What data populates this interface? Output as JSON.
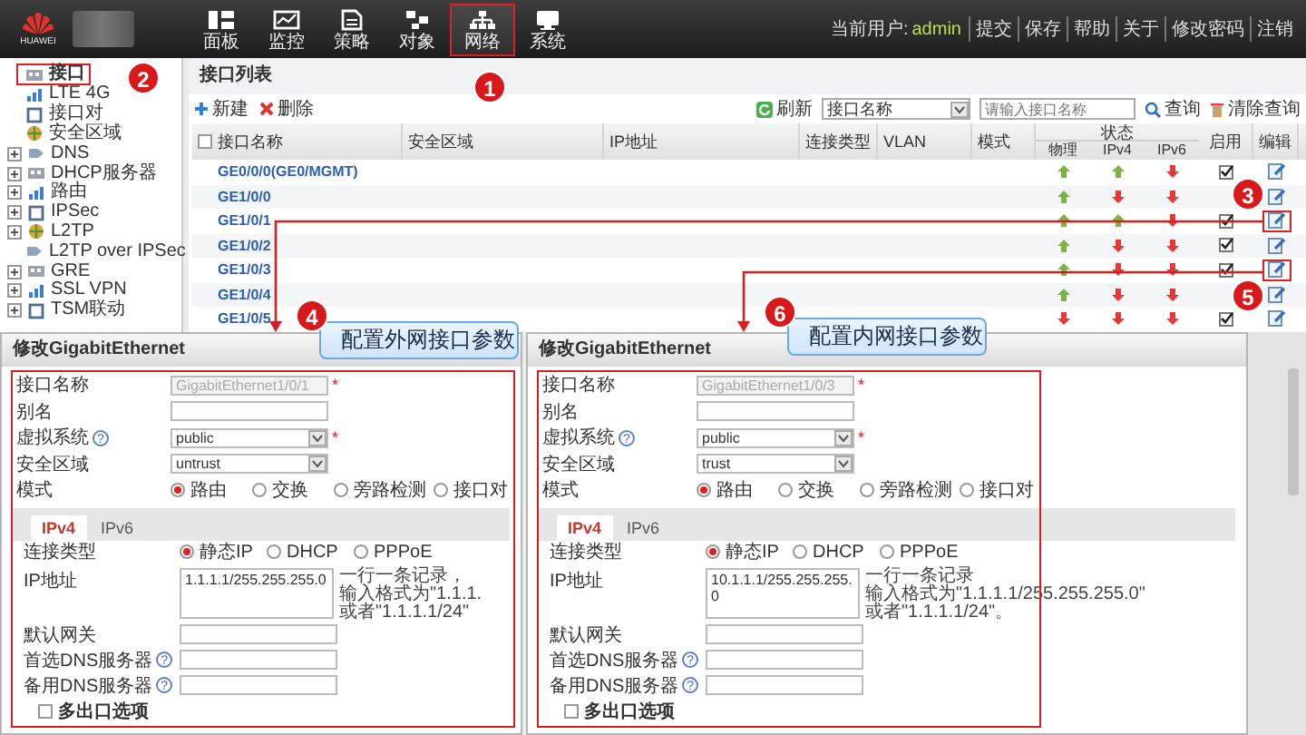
{
  "top_bar": {
    "logo_text": "HUAWEI",
    "nav": [
      {
        "label": "面板",
        "selected": false,
        "highlighted": false
      },
      {
        "label": "监控",
        "selected": false,
        "highlighted": false
      },
      {
        "label": "策略",
        "selected": false,
        "highlighted": false
      },
      {
        "label": "对象",
        "selected": false,
        "highlighted": false
      },
      {
        "label": "网络",
        "selected": true,
        "highlighted": true
      },
      {
        "label": "系统",
        "selected": false,
        "highlighted": false
      }
    ],
    "user_label": "当前用户:",
    "user": "admin",
    "links": [
      "提交",
      "保存",
      "帮助",
      "关于",
      "修改密码",
      "注销"
    ]
  },
  "sidebar": {
    "items": [
      {
        "label": "接口",
        "kind": "leaf",
        "selected": true,
        "highlighted": true
      },
      {
        "label": "LTE 4G",
        "kind": "leaf",
        "selected": false,
        "highlighted": false
      },
      {
        "label": "接口对",
        "kind": "leaf",
        "selected": false,
        "highlighted": false
      },
      {
        "label": "安全区域",
        "kind": "leaf",
        "selected": false,
        "highlighted": false
      },
      {
        "label": "DNS",
        "kind": "folder",
        "expanded": false,
        "selected": false,
        "highlighted": false
      },
      {
        "label": "DHCP服务器",
        "kind": "folder",
        "expanded": false,
        "selected": false,
        "highlighted": false
      },
      {
        "label": "路由",
        "kind": "folder",
        "expanded": false,
        "selected": false,
        "highlighted": false
      },
      {
        "label": "IPSec",
        "kind": "folder",
        "expanded": false,
        "selected": false,
        "highlighted": false
      },
      {
        "label": "L2TP",
        "kind": "folder",
        "expanded": false,
        "selected": false,
        "highlighted": false
      },
      {
        "label": "L2TP over IPSec",
        "kind": "leaf",
        "selected": false,
        "highlighted": false
      },
      {
        "label": "GRE",
        "kind": "folder",
        "expanded": false,
        "selected": false,
        "highlighted": false
      },
      {
        "label": "SSL VPN",
        "kind": "folder",
        "expanded": false,
        "selected": false,
        "highlighted": false
      },
      {
        "label": "TSM联动",
        "kind": "folder",
        "expanded": false,
        "selected": false,
        "highlighted": false
      }
    ]
  },
  "interface_list": {
    "title": "接口列表",
    "toolbar": {
      "new": "新建",
      "delete": "删除",
      "refresh": "刷新",
      "filter_field": "接口名称",
      "search_placeholder": "请输入接口名称",
      "search": "查询",
      "clear": "清除查询"
    },
    "table": {
      "header_checked": false,
      "columns": [
        "接口名称",
        "安全区域",
        "IP地址",
        "连接类型",
        "VLAN",
        "模式"
      ],
      "status_header": "状态",
      "status_columns": [
        "物理",
        "IPv4",
        "IPv6"
      ],
      "enable_header": "启用",
      "edit_header": "编辑",
      "rows": [
        {
          "name": "GE0/0/0(GE0/MGMT)",
          "physical_up": true,
          "ipv4_up": true,
          "ipv6_up": false,
          "enabled": true,
          "highlighted": false
        },
        {
          "name": "GE1/0/0",
          "physical_up": true,
          "ipv4_up": false,
          "ipv6_up": false,
          "enabled": false,
          "highlighted": false
        },
        {
          "name": "GE1/0/1",
          "physical_up": true,
          "ipv4_up": true,
          "ipv6_up": false,
          "enabled": true,
          "highlighted": true
        },
        {
          "name": "GE1/0/2",
          "physical_up": true,
          "ipv4_up": false,
          "ipv6_up": false,
          "enabled": true,
          "highlighted": false
        },
        {
          "name": "GE1/0/3",
          "physical_up": true,
          "ipv4_up": false,
          "ipv6_up": false,
          "enabled": true,
          "highlighted": true
        },
        {
          "name": "GE1/0/4",
          "physical_up": true,
          "ipv4_up": false,
          "ipv6_up": false,
          "enabled": false,
          "highlighted": false
        },
        {
          "name": "GE1/0/5",
          "physical_up": false,
          "ipv4_up": false,
          "ipv6_up": false,
          "enabled": true,
          "highlighted": false
        }
      ]
    }
  },
  "markers": [
    {
      "number": "1"
    },
    {
      "number": "2"
    },
    {
      "number": "3"
    },
    {
      "number": "5"
    }
  ],
  "dialogs": [
    {
      "title": "修改GigabitEthernet",
      "callout": {
        "number": "4",
        "text": "配置外网接口参数"
      },
      "fields": [
        {
          "kind": "text",
          "label": "接口名称",
          "value": "GigabitEthernet1/0/1",
          "disabled": true,
          "mark": "*"
        },
        {
          "kind": "text",
          "label": "别名",
          "disabled": false
        },
        {
          "kind": "select",
          "label": "虚拟系统",
          "help": "?",
          "value": "public",
          "mark": "*"
        },
        {
          "kind": "select",
          "label": "安全区域",
          "value": "untrust"
        },
        {
          "kind": "radio",
          "label": "模式",
          "options": [
            {
              "label": "路由",
              "selected": true
            },
            {
              "label": "交换",
              "selected": false
            },
            {
              "label": "旁路检测",
              "selected": false
            },
            {
              "label": "接口对",
              "selected": false
            }
          ]
        }
      ],
      "tabs": [
        {
          "label": "IPv4",
          "selected": true
        },
        {
          "label": "IPv6",
          "selected": false
        }
      ],
      "tab_fields": [
        {
          "kind": "radio",
          "label": "连接类型",
          "options": [
            {
              "label": "静态IP",
              "selected": true
            },
            {
              "label": "DHCP",
              "selected": false
            },
            {
              "label": "PPPoE",
              "selected": false
            }
          ]
        },
        {
          "kind": "textarea",
          "label": "IP地址",
          "value": "1.1.1.1/255.255.255.0",
          "hint": [
            "一行一条记录，",
            "输入格式为\"1.1.1.",
            "或者\"1.1.1.1/24\""
          ]
        },
        {
          "kind": "text",
          "label": "默认网关",
          "disabled": false
        },
        {
          "kind": "text",
          "label": "首选DNS服务器",
          "help": "?",
          "disabled": false
        },
        {
          "kind": "text",
          "label": "备用DNS服务器",
          "help": "?",
          "disabled": false
        }
      ],
      "option": {
        "label": "多出口选项",
        "checked": false
      }
    },
    {
      "title": "修改GigabitEthernet",
      "callout": {
        "number": "6",
        "text": "配置内网接口参数"
      },
      "fields": [
        {
          "kind": "text",
          "label": "接口名称",
          "value": "GigabitEthernet1/0/3",
          "disabled": true,
          "mark": "*"
        },
        {
          "kind": "text",
          "label": "别名",
          "disabled": false
        },
        {
          "kind": "select",
          "label": "虚拟系统",
          "help": "?",
          "value": "public",
          "mark": "*"
        },
        {
          "kind": "select",
          "label": "安全区域",
          "value": "trust"
        },
        {
          "kind": "radio",
          "label": "模式",
          "options": [
            {
              "label": "路由",
              "selected": true
            },
            {
              "label": "交换",
              "selected": false
            },
            {
              "label": "旁路检测",
              "selected": false
            },
            {
              "label": "接口对",
              "selected": false
            }
          ]
        }
      ],
      "tabs": [
        {
          "label": "IPv4",
          "selected": true
        },
        {
          "label": "IPv6",
          "selected": false
        }
      ],
      "tab_fields": [
        {
          "kind": "radio",
          "label": "连接类型",
          "options": [
            {
              "label": "静态IP",
              "selected": true
            },
            {
              "label": "DHCP",
              "selected": false
            },
            {
              "label": "PPPoE",
              "selected": false
            }
          ]
        },
        {
          "kind": "textarea",
          "label": "IP地址",
          "value": "10.1.1.1/255.255.255.0",
          "hint": [
            "一行一条记录",
            "输入格式为\"1.1.1.1/255.255.255.0\"",
            "或者\"1.1.1.1/24\"。"
          ]
        },
        {
          "kind": "text",
          "label": "默认网关",
          "disabled": false
        },
        {
          "kind": "text",
          "label": "首选DNS服务器",
          "help": "?",
          "disabled": false
        },
        {
          "kind": "text",
          "label": "备用DNS服务器",
          "help": "?",
          "disabled": false
        }
      ],
      "option": {
        "label": "多出口选项",
        "checked": false
      }
    }
  ]
}
